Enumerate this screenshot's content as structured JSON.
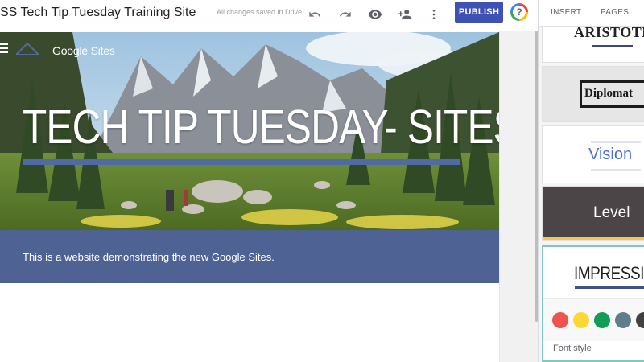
{
  "toolbar": {
    "doc_title": "SS Tech Tip Tuesday Training Site",
    "saved_status": "All changes saved in Drive",
    "publish_label": "PUBLISH",
    "help_label": "?",
    "icons": [
      "undo-icon",
      "redo-icon",
      "eye-icon",
      "add-person-icon",
      "more-vert-icon",
      "help-icon"
    ]
  },
  "site": {
    "name": "Google Sites",
    "hero_title": "TECH TIP TUESDAY- SITES",
    "description": "This is a website demonstrating the new Google Sites."
  },
  "panel": {
    "tabs": [
      "INSERT",
      "PAGES"
    ],
    "themes": [
      {
        "label": "ARISTOTLE"
      },
      {
        "label": "Diplomat"
      },
      {
        "label": "Vision"
      },
      {
        "label": "Level"
      },
      {
        "label": "IMPRESSION"
      }
    ],
    "swatches": [
      "#ef5350",
      "#fdd835",
      "#0f9d58",
      "#607d8b",
      "#424242"
    ],
    "font_style_label": "Font style"
  },
  "colors": {
    "publish": "#3f51b5",
    "hero_underline": "#4f6ba3",
    "description_band": "#4f6294",
    "selected_theme_border": "#7fcac0"
  }
}
